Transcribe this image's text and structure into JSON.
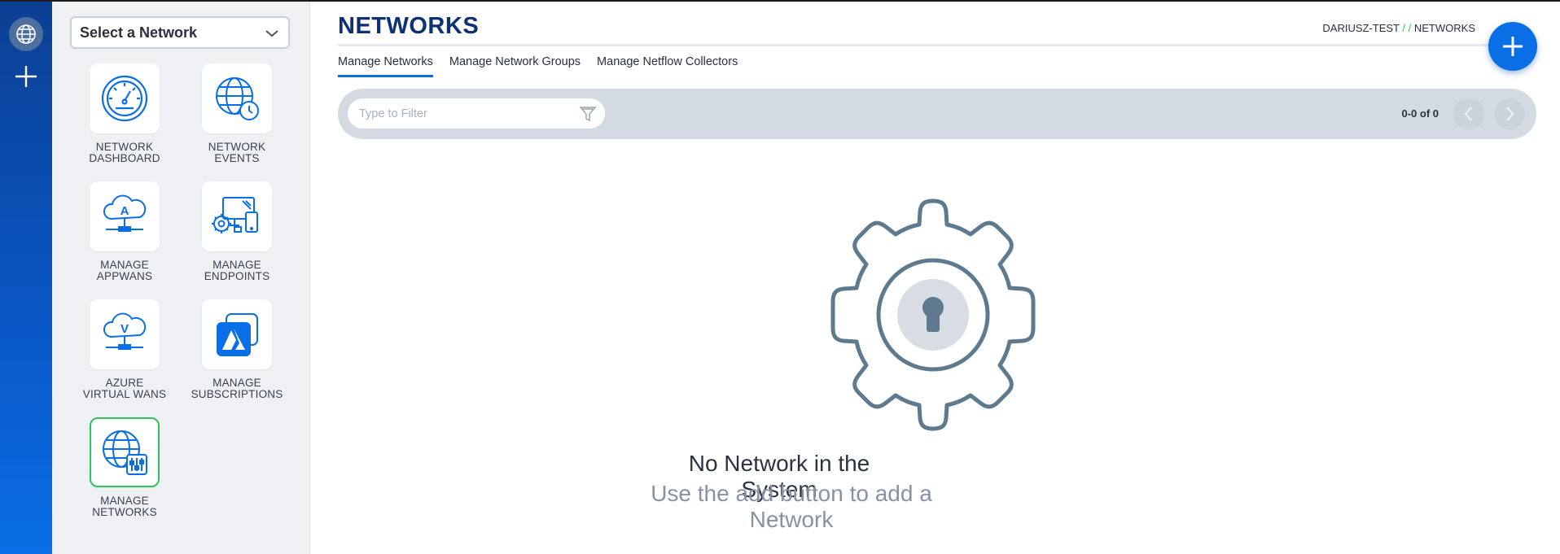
{
  "sidebar": {
    "network_select": {
      "label": "Select a Network"
    },
    "tiles": [
      {
        "line1": "NETWORK",
        "line2": "DASHBOARD",
        "icon": "gauge-icon"
      },
      {
        "line1": "NETWORK",
        "line2": "EVENTS",
        "icon": "globe-clock-icon"
      },
      {
        "line1": "MANAGE",
        "line2": "APPWANS",
        "icon": "cloud-a-icon"
      },
      {
        "line1": "MANAGE",
        "line2": "ENDPOINTS",
        "icon": "devices-icon"
      },
      {
        "line1": "AZURE",
        "line2": "VIRTUAL WANS",
        "icon": "cloud-v-icon"
      },
      {
        "line1": "MANAGE",
        "line2": "SUBSCRIPTIONS",
        "icon": "azure-icon"
      },
      {
        "line1": "MANAGE",
        "line2": "NETWORKS",
        "icon": "globe-settings-icon"
      }
    ]
  },
  "header": {
    "title": "NETWORKS",
    "breadcrumb": {
      "org": "DARIUSZ-TEST",
      "sep": "/ /",
      "page": "NETWORKS"
    }
  },
  "tabs": [
    {
      "label": "Manage Networks",
      "active": true
    },
    {
      "label": "Manage Network Groups",
      "active": false
    },
    {
      "label": "Manage Netflow Collectors",
      "active": false
    }
  ],
  "filter": {
    "placeholder": "Type to Filter",
    "count": "0-0 of 0"
  },
  "empty_state": {
    "title": "No Network in the System",
    "subtitle": "Use the add button to add a Network"
  },
  "colors": {
    "brand_dark": "#0c3175",
    "accent": "#0a6ee6",
    "success": "#2ec45a",
    "icon_gray": "#5e7a8e"
  }
}
